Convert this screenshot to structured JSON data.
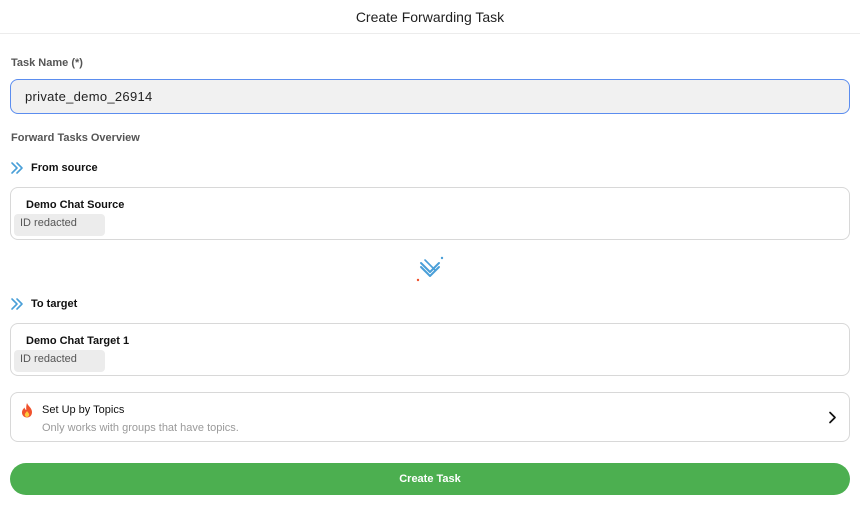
{
  "header": {
    "title": "Create Forwarding Task"
  },
  "task_name": {
    "label": "Task Name (*)",
    "value": "private_demo_26914"
  },
  "overview": {
    "label": "Forward Tasks Overview"
  },
  "source": {
    "heading": "From source",
    "icon": "double-chevron-right-icon",
    "name": "Demo Chat Source",
    "id_text": "ID redacted"
  },
  "target": {
    "heading": "To target",
    "icon": "double-chevron-right-icon",
    "name": "Demo Chat Target 1",
    "id_text": "ID redacted"
  },
  "swap": {
    "icon": "swap-direction-icon"
  },
  "topics": {
    "icon": "fire-icon",
    "title": "Set Up by Topics",
    "subtitle": "Only works with groups that have topics."
  },
  "actions": {
    "create_label": "Create Task"
  },
  "colors": {
    "accent_green": "#4caf50",
    "focus_blue": "#5b8def",
    "icon_blue": "#4a9fd8",
    "fire_orange": "#f0522d"
  }
}
